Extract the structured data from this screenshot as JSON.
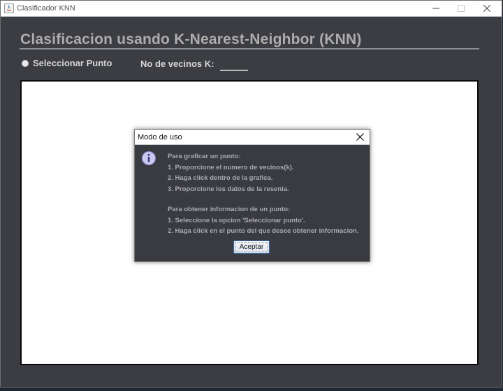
{
  "window": {
    "title": "Clasificador KNN"
  },
  "header": {
    "title": "Clasificacion usando K-Nearest-Neighbor (KNN)"
  },
  "controls": {
    "select_point_label": "Seleccionar Punto",
    "k_label": "No de vecinos K:",
    "k_value": ""
  },
  "dialog": {
    "title": "Modo de uso",
    "icon": "info-icon",
    "lines": [
      "Para graficar un punto:",
      "1. Proporcione el numero de vecinos(k).",
      "2. Haga click dentro de la grafica.",
      "3. Proporcione los datos de la resenia.",
      "",
      "Para obtener informacion de un punto:",
      "1. Seleccione la opcion 'Seleccionar punto'.",
      "2. Haga click en el punto del que desee obtener informacion."
    ],
    "accept_label": "Aceptar"
  },
  "colors": {
    "background": "#3c3d42",
    "canvas": "#ffffff",
    "text": "#d6d6d6",
    "accent_border": "#3b6fb3"
  }
}
